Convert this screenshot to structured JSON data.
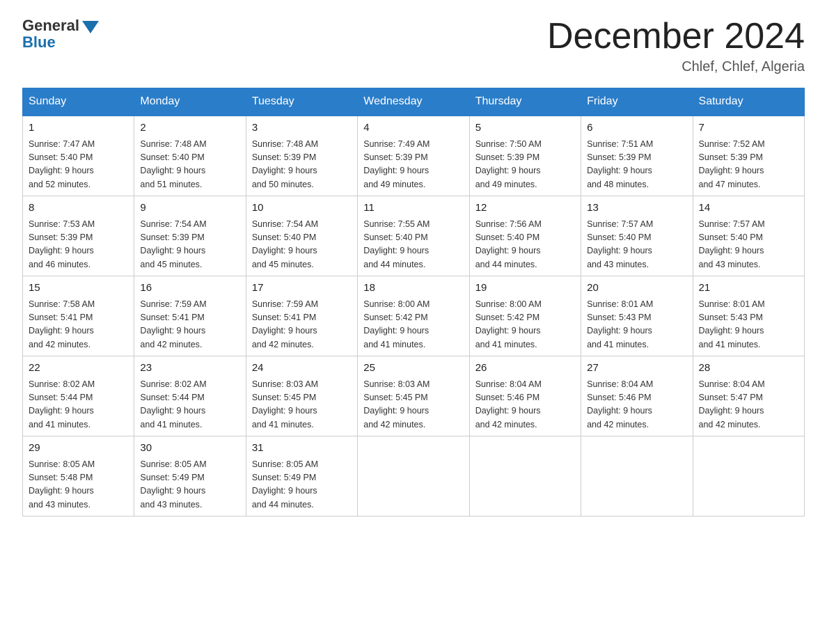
{
  "header": {
    "logo_general": "General",
    "logo_blue": "Blue",
    "month_title": "December 2024",
    "location": "Chlef, Chlef, Algeria"
  },
  "weekdays": [
    "Sunday",
    "Monday",
    "Tuesday",
    "Wednesday",
    "Thursday",
    "Friday",
    "Saturday"
  ],
  "weeks": [
    [
      {
        "day": "1",
        "sunrise": "7:47 AM",
        "sunset": "5:40 PM",
        "daylight": "9 hours and 52 minutes."
      },
      {
        "day": "2",
        "sunrise": "7:48 AM",
        "sunset": "5:40 PM",
        "daylight": "9 hours and 51 minutes."
      },
      {
        "day": "3",
        "sunrise": "7:48 AM",
        "sunset": "5:39 PM",
        "daylight": "9 hours and 50 minutes."
      },
      {
        "day": "4",
        "sunrise": "7:49 AM",
        "sunset": "5:39 PM",
        "daylight": "9 hours and 49 minutes."
      },
      {
        "day": "5",
        "sunrise": "7:50 AM",
        "sunset": "5:39 PM",
        "daylight": "9 hours and 49 minutes."
      },
      {
        "day": "6",
        "sunrise": "7:51 AM",
        "sunset": "5:39 PM",
        "daylight": "9 hours and 48 minutes."
      },
      {
        "day": "7",
        "sunrise": "7:52 AM",
        "sunset": "5:39 PM",
        "daylight": "9 hours and 47 minutes."
      }
    ],
    [
      {
        "day": "8",
        "sunrise": "7:53 AM",
        "sunset": "5:39 PM",
        "daylight": "9 hours and 46 minutes."
      },
      {
        "day": "9",
        "sunrise": "7:54 AM",
        "sunset": "5:39 PM",
        "daylight": "9 hours and 45 minutes."
      },
      {
        "day": "10",
        "sunrise": "7:54 AM",
        "sunset": "5:40 PM",
        "daylight": "9 hours and 45 minutes."
      },
      {
        "day": "11",
        "sunrise": "7:55 AM",
        "sunset": "5:40 PM",
        "daylight": "9 hours and 44 minutes."
      },
      {
        "day": "12",
        "sunrise": "7:56 AM",
        "sunset": "5:40 PM",
        "daylight": "9 hours and 44 minutes."
      },
      {
        "day": "13",
        "sunrise": "7:57 AM",
        "sunset": "5:40 PM",
        "daylight": "9 hours and 43 minutes."
      },
      {
        "day": "14",
        "sunrise": "7:57 AM",
        "sunset": "5:40 PM",
        "daylight": "9 hours and 43 minutes."
      }
    ],
    [
      {
        "day": "15",
        "sunrise": "7:58 AM",
        "sunset": "5:41 PM",
        "daylight": "9 hours and 42 minutes."
      },
      {
        "day": "16",
        "sunrise": "7:59 AM",
        "sunset": "5:41 PM",
        "daylight": "9 hours and 42 minutes."
      },
      {
        "day": "17",
        "sunrise": "7:59 AM",
        "sunset": "5:41 PM",
        "daylight": "9 hours and 42 minutes."
      },
      {
        "day": "18",
        "sunrise": "8:00 AM",
        "sunset": "5:42 PM",
        "daylight": "9 hours and 41 minutes."
      },
      {
        "day": "19",
        "sunrise": "8:00 AM",
        "sunset": "5:42 PM",
        "daylight": "9 hours and 41 minutes."
      },
      {
        "day": "20",
        "sunrise": "8:01 AM",
        "sunset": "5:43 PM",
        "daylight": "9 hours and 41 minutes."
      },
      {
        "day": "21",
        "sunrise": "8:01 AM",
        "sunset": "5:43 PM",
        "daylight": "9 hours and 41 minutes."
      }
    ],
    [
      {
        "day": "22",
        "sunrise": "8:02 AM",
        "sunset": "5:44 PM",
        "daylight": "9 hours and 41 minutes."
      },
      {
        "day": "23",
        "sunrise": "8:02 AM",
        "sunset": "5:44 PM",
        "daylight": "9 hours and 41 minutes."
      },
      {
        "day": "24",
        "sunrise": "8:03 AM",
        "sunset": "5:45 PM",
        "daylight": "9 hours and 41 minutes."
      },
      {
        "day": "25",
        "sunrise": "8:03 AM",
        "sunset": "5:45 PM",
        "daylight": "9 hours and 42 minutes."
      },
      {
        "day": "26",
        "sunrise": "8:04 AM",
        "sunset": "5:46 PM",
        "daylight": "9 hours and 42 minutes."
      },
      {
        "day": "27",
        "sunrise": "8:04 AM",
        "sunset": "5:46 PM",
        "daylight": "9 hours and 42 minutes."
      },
      {
        "day": "28",
        "sunrise": "8:04 AM",
        "sunset": "5:47 PM",
        "daylight": "9 hours and 42 minutes."
      }
    ],
    [
      {
        "day": "29",
        "sunrise": "8:05 AM",
        "sunset": "5:48 PM",
        "daylight": "9 hours and 43 minutes."
      },
      {
        "day": "30",
        "sunrise": "8:05 AM",
        "sunset": "5:49 PM",
        "daylight": "9 hours and 43 minutes."
      },
      {
        "day": "31",
        "sunrise": "8:05 AM",
        "sunset": "5:49 PM",
        "daylight": "9 hours and 44 minutes."
      },
      null,
      null,
      null,
      null
    ]
  ],
  "sunrise_label": "Sunrise: ",
  "sunset_label": "Sunset: ",
  "daylight_label": "Daylight: "
}
